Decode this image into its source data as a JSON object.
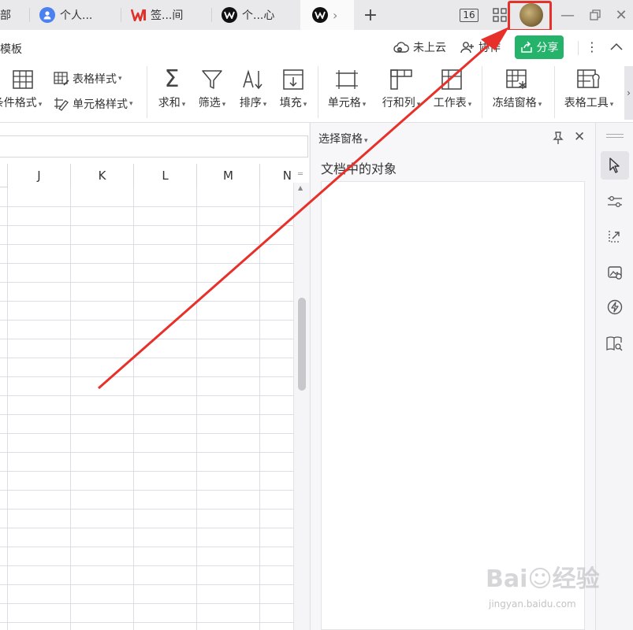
{
  "tabs": [
    {
      "label": "部"
    },
    {
      "label": "个人..."
    },
    {
      "label": "签...间"
    },
    {
      "label": "个...心"
    }
  ],
  "titlebar": {
    "counter": "16",
    "add_icon": "plus-icon"
  },
  "ribbon": {
    "template_label": "模板",
    "cloud_label": "未上云",
    "collab_label": "协作",
    "share_label": "分享",
    "table_style": "表格样式",
    "cell_style": "单元格样式",
    "cond_format": "条件格式",
    "tools": {
      "sum": "求和",
      "filter": "筛选",
      "sort": "排序",
      "fill": "填充",
      "cell": "单元格",
      "rowcol": "行和列",
      "sheet": "工作表",
      "freeze": "冻结窗格",
      "tabletools": "表格工具"
    }
  },
  "sheet": {
    "columns": [
      "J",
      "K",
      "L",
      "M",
      "N"
    ]
  },
  "pane": {
    "title": "选择窗格",
    "subtitle": "文档中的对象"
  },
  "watermark": {
    "brand": "Bai☺经验",
    "url": "jingyan.baidu.com"
  },
  "colors": {
    "share_green": "#25b36b",
    "annotation_red": "#e8302a",
    "wps_red": "#e0302a"
  }
}
